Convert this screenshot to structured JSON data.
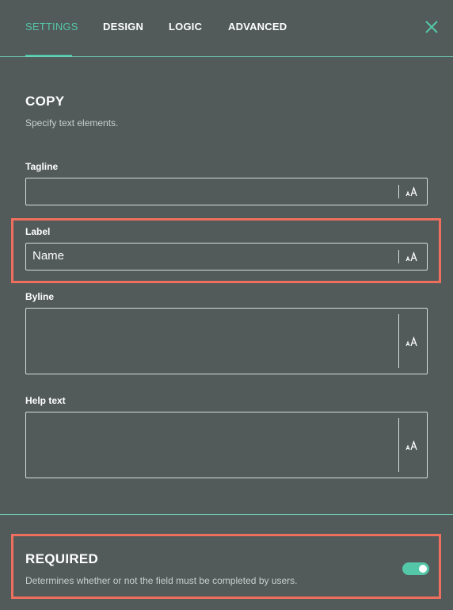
{
  "tabs": [
    {
      "label": "SETTINGS",
      "active": true
    },
    {
      "label": "DESIGN",
      "active": false
    },
    {
      "label": "LOGIC",
      "active": false
    },
    {
      "label": "ADVANCED",
      "active": false
    }
  ],
  "copy": {
    "title": "COPY",
    "description": "Specify text elements."
  },
  "fields": {
    "tagline": {
      "label": "Tagline",
      "value": ""
    },
    "label": {
      "label": "Label",
      "value": "Name"
    },
    "byline": {
      "label": "Byline",
      "value": ""
    },
    "help_text": {
      "label": "Help text",
      "value": ""
    }
  },
  "required": {
    "title": "REQUIRED",
    "description": "Determines whether or not the field must be completed by users.",
    "enabled": true
  },
  "colors": {
    "background": "#525a5a",
    "accent": "#54c7a8",
    "highlight": "#ef6f5e"
  },
  "icons": {
    "close": "close-icon",
    "text_size": "text-size-icon",
    "toggle": "toggle-switch"
  }
}
